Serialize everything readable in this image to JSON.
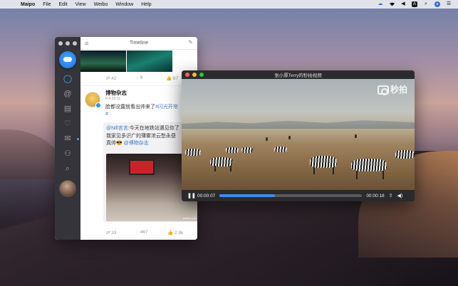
{
  "menubar": {
    "apple": "",
    "app": "Maipo",
    "items": [
      "File",
      "Edit",
      "View",
      "Weibo",
      "Window",
      "Help"
    ],
    "status_icons": [
      "cloud-icon",
      "wifi-icon",
      "volume-icon",
      "input-source-icon",
      "search-icon",
      "siri-icon",
      "list-icon"
    ],
    "input_source_label": "A"
  },
  "maipo": {
    "title": "Timeline",
    "prev_post_stats": {
      "reposts": "42",
      "comments": "9",
      "likes": "87"
    },
    "post": {
      "author": "博物杂志",
      "time": "6-4 23:11",
      "text_plain": "脸都没露就看出帅来了",
      "text_tag": "#闪光开帘",
      "text_tag_end": "#",
      "repost_user": "@Nill言言",
      "repost_line1": ":今天在地铁站遇见你了",
      "repost_line2": "我家见多识广的薄雾浓云愁永昼",
      "repost_line3": "真帅😎",
      "repost_mention": "@博物杂志",
      "image_watermark": "weibo.com",
      "stats": {
        "reposts": "33",
        "comments": "467",
        "likes": "2.9k"
      }
    }
  },
  "video": {
    "title": "张小厚Terry的秒拍视频",
    "watermark": "秒拍",
    "current_time": "00:00:07",
    "duration": "00:00:18",
    "progress": 0.39
  },
  "colors": {
    "accent": "#3d8de8",
    "sidebar": "#34343a",
    "link": "#3a78c8"
  }
}
